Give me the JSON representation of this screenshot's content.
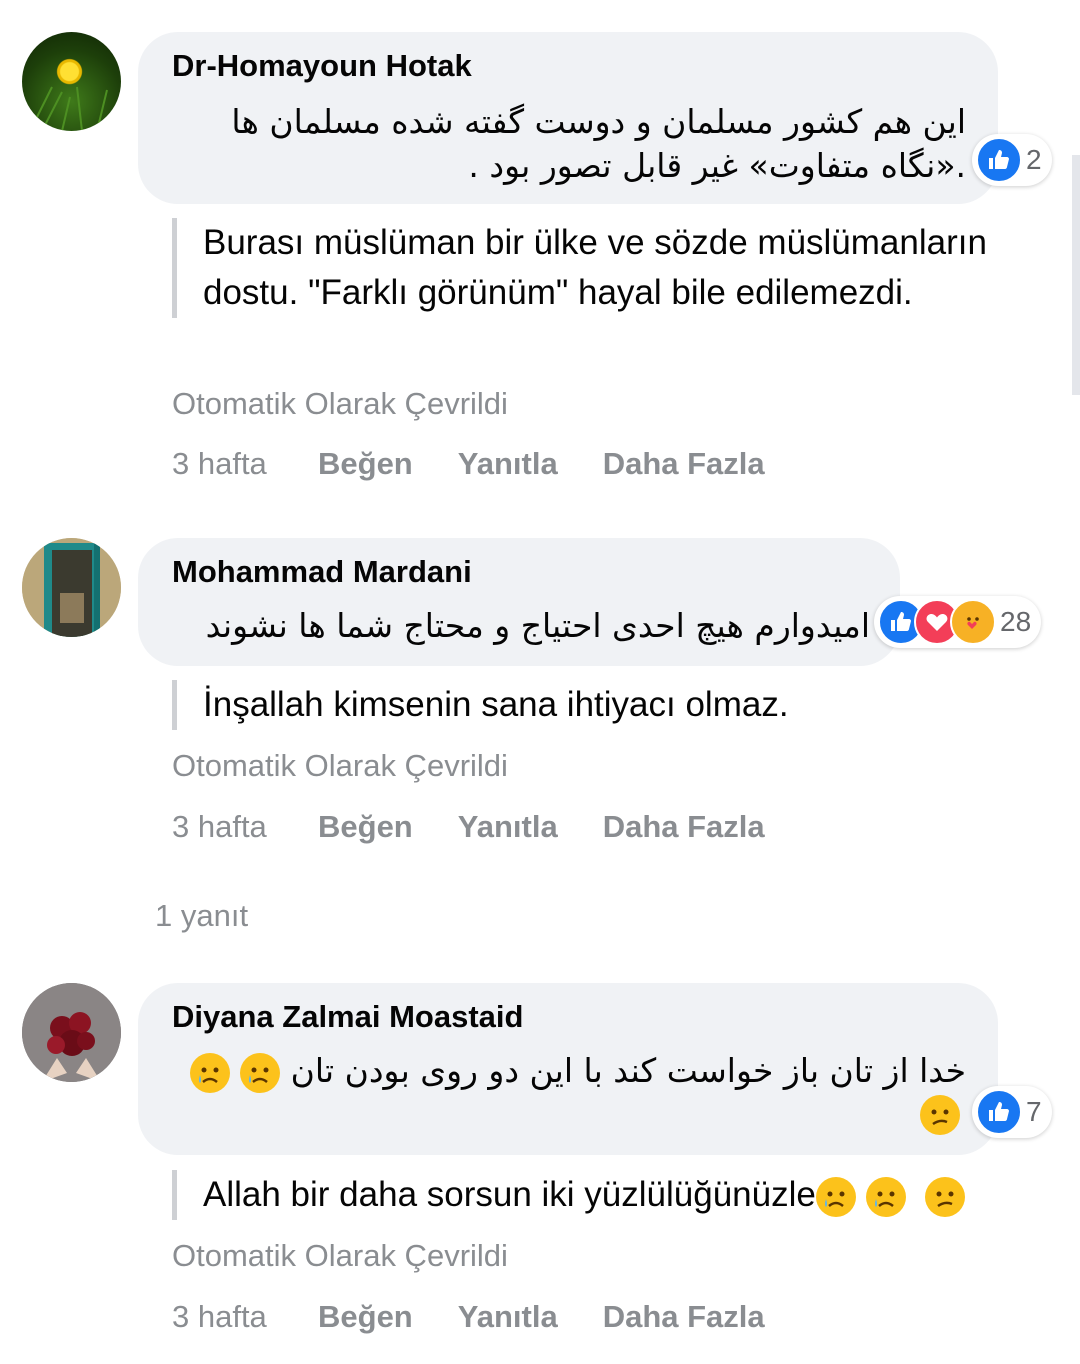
{
  "comments": [
    {
      "author": "Dr-Homayoun Hotak",
      "text_line1": "این هم کشور مسلمان و دوست گفته شده مسلمان ها",
      "text_line2": ".«نگاه متفاوت» غیر قابل تصور بود .",
      "reaction_count": "2",
      "reactions": [
        "like-icon"
      ],
      "translation": "Burası müslüman bir ülke ve sözde müslümanların dostu. \"Farklı görünüm\" hayal bile edilemezdi.",
      "auto_translated": "Otomatik Olarak Çevrildi",
      "time": "3 hafta",
      "like": "Beğen",
      "reply": "Yanıtla",
      "more": "Daha Fazla"
    },
    {
      "author": "Mohammad Mardani",
      "text_line1": "امیدوارم هیچ احدی احتیاج و محتاج شما ها نشوند",
      "reaction_count": "28",
      "reactions": [
        "like-icon",
        "love-icon",
        "care-icon"
      ],
      "translation": "İnşallah kimsenin sana ihtiyacı olmaz.",
      "auto_translated": "Otomatik Olarak Çevrildi",
      "time": "3 hafta",
      "like": "Beğen",
      "reply": "Yanıtla",
      "more": "Daha Fazla",
      "replies": "1 yanıt"
    },
    {
      "author": "Diyana Zalmai Moastaid",
      "text_line1": "خدا از تان باز خواست کند با این دو روی بودن تان",
      "reaction_count": "7",
      "reactions": [
        "like-icon"
      ],
      "translation": "Allah bir daha sorsun iki yüzlülüğünüzle",
      "auto_translated": "Otomatik Olarak Çevrildi",
      "time": "3 hafta",
      "like": "Beğen",
      "reply": "Yanıtla",
      "more": "Daha Fazla"
    }
  ],
  "colors": {
    "bubble": "#f0f2f5",
    "like_blue": "#1877f2",
    "love_red": "#f33e58",
    "muted_text": "#8a8d91"
  }
}
